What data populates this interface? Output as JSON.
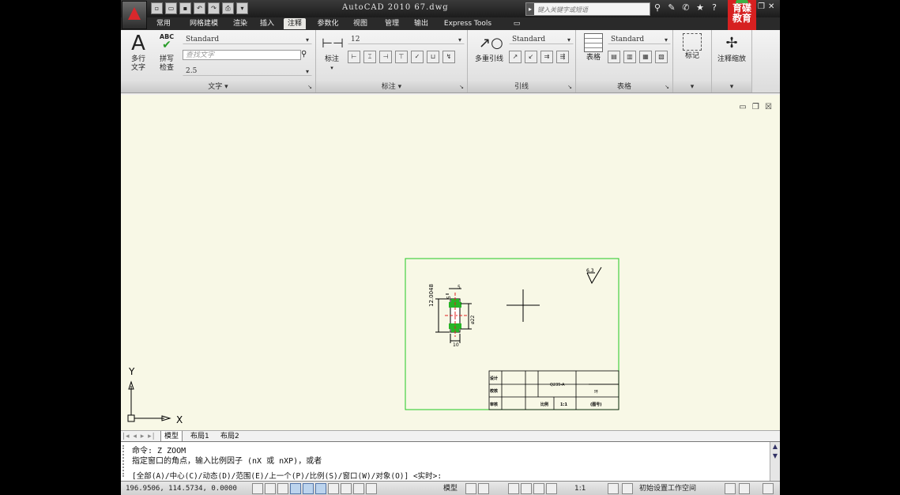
{
  "window": {
    "title": "AutoCAD 2010   67.dwg",
    "search_placeholder": "键入关键字或短语",
    "brand_text": "育碟教育"
  },
  "tabs": [
    "常用",
    "网格建模",
    "渲染",
    "插入",
    "注释",
    "参数化",
    "视图",
    "管理",
    "输出",
    "Express Tools"
  ],
  "active_tab": "注释",
  "ribbon": {
    "text_panel": {
      "title": "文字",
      "mtext_label_1": "多行",
      "mtext_label_2": "文字",
      "spell_label_1": "拼写",
      "spell_label_2": "检查",
      "abc": "ABC",
      "style": "Standard",
      "find_placeholder": "查找文字",
      "height": "2.5"
    },
    "dim_panel": {
      "title": "标注",
      "dim_label": "标注",
      "dim_style": "12"
    },
    "leader_panel": {
      "title": "引线",
      "mleader_label": "多重引线",
      "style": "Standard"
    },
    "table_panel": {
      "title": "表格",
      "table_label": "表格",
      "style": "Standard"
    },
    "markup_panel": {
      "label": "标记"
    },
    "scale_panel": {
      "label": "注释缩放"
    }
  },
  "drawing": {
    "ucs_x": "X",
    "ucs_y": "Y",
    "roughness": "6.3",
    "dims": {
      "d1": "12.0048",
      "d2": "5",
      "d3": "5",
      "d4": "ø22",
      "d5": "10"
    },
    "title_block": {
      "designer": "设计",
      "checker": "校核",
      "reviewer": "审核",
      "part_code": "Q235-A",
      "part_name": "环",
      "scale_label": "比例",
      "scale_value": "1:1",
      "drawing_no": "(图号)"
    }
  },
  "layout_tabs": [
    "模型",
    "布局1",
    "布局2"
  ],
  "active_layout": "模型",
  "command": {
    "line1": "命令: Z ZOOM",
    "line2": "指定窗口的角点，输入比例因子 (nX 或 nXP)，或者",
    "line3": "[全部(A)/中心(C)/动态(D)/范围(E)/上一个(P)/比例(S)/窗口(W)/对象(O)] <实时>:"
  },
  "status": {
    "coords": "196.9506, 114.5734, 0.0000",
    "model_label": "模型",
    "anno_scale": "1:1",
    "workspace": "初始设置工作空间"
  }
}
